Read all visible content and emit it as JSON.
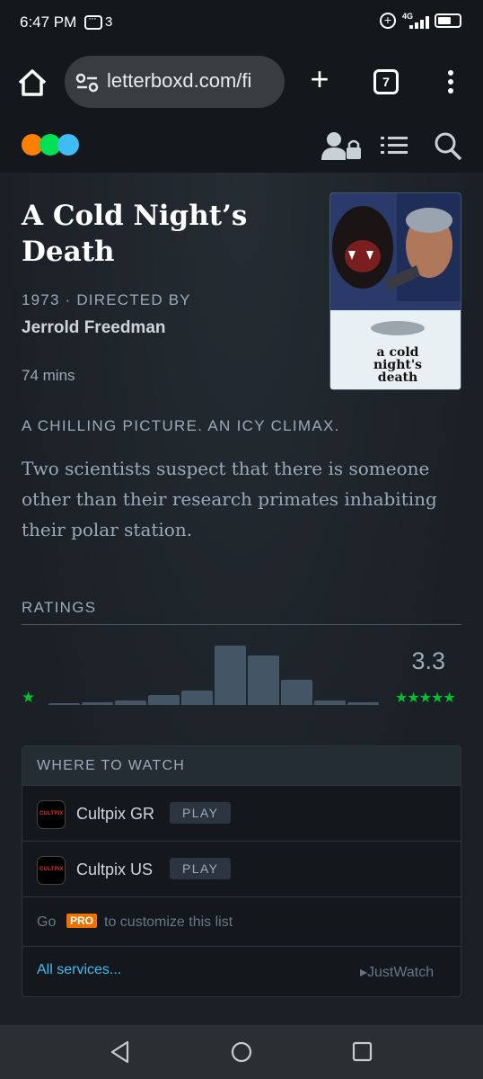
{
  "status_bar": {
    "time": "6:47 PM",
    "notif_count": "3",
    "network": "4G"
  },
  "browser": {
    "url": "letterboxd.com/fi",
    "tab_count": "7"
  },
  "site": {
    "logo_colors": [
      "#ff8000",
      "#00e054",
      "#40bcf4"
    ]
  },
  "film": {
    "title": "A Cold Night’s Death",
    "year_directed": "1973 · DIRECTED BY",
    "director": "Jerrold Freedman",
    "runtime": "74 mins",
    "poster_text": "a cold night's death",
    "tagline": "A CHILLING PICTURE. AN ICY CLIMAX.",
    "synopsis": "Two scientists suspect that there is someone other than their research primates inhabiting their polar station."
  },
  "ratings": {
    "heading": "RATINGS",
    "average": "3.3",
    "min_star": "★",
    "max_stars": "★★★★★",
    "histogram": [
      2,
      3,
      5,
      11,
      16,
      65,
      54,
      28,
      5,
      3
    ]
  },
  "where_to_watch": {
    "heading": "WHERE TO WATCH",
    "services": [
      {
        "name": "Cultpix GR",
        "logo": "CULTPIX",
        "action": "PLAY"
      },
      {
        "name": "Cultpix US",
        "logo": "CULTPIX",
        "action": "PLAY"
      }
    ],
    "go": "Go",
    "pro": "PRO",
    "customize": "to customize this list",
    "all_services": "All services...",
    "provider": "JustWatch"
  },
  "colors": {
    "accent_green": "#00c030",
    "accent_blue": "#40bcf4",
    "pro_orange": "#ee7000"
  }
}
